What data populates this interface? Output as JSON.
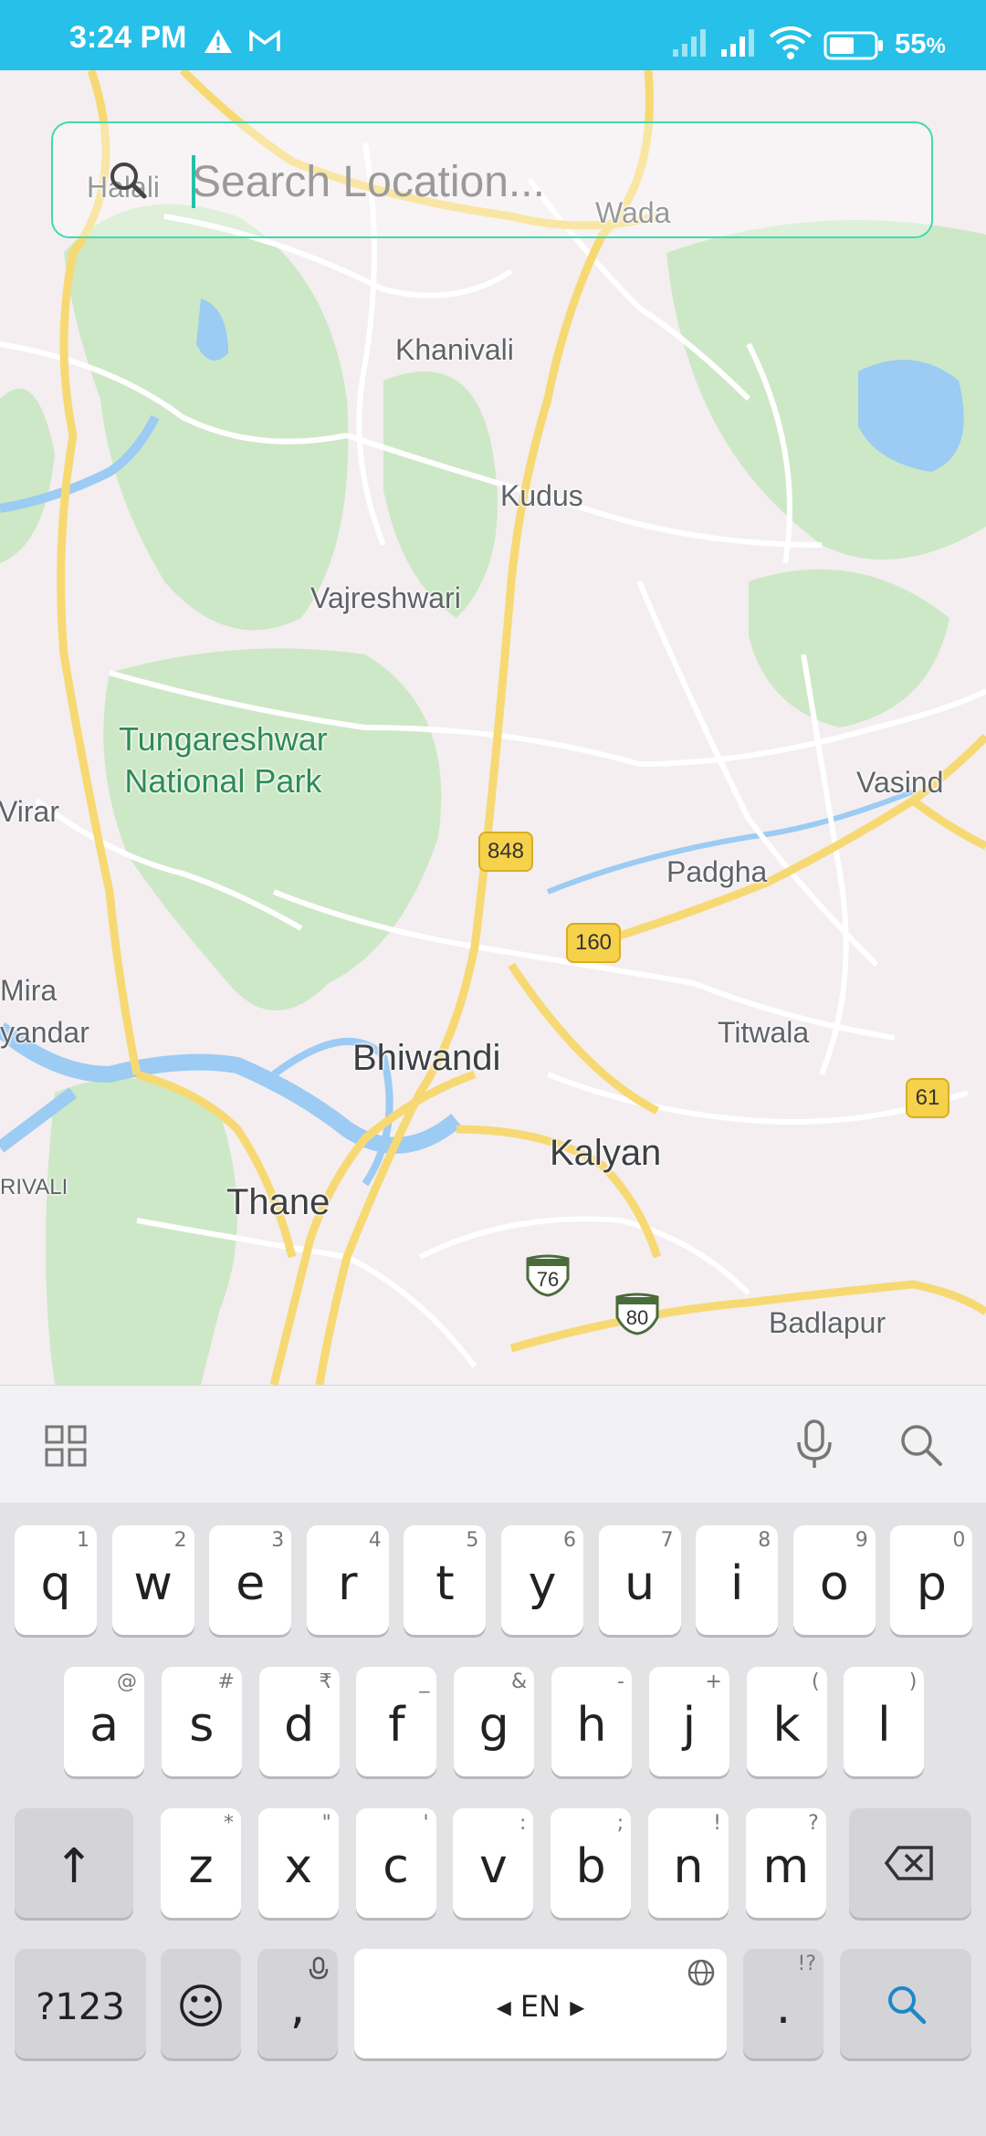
{
  "status_bar": {
    "time": "3:24 PM",
    "battery_percent": "55",
    "battery_unit": "%",
    "icons": [
      "alert-icon",
      "gmail-icon",
      "signal-icon",
      "signal-icon",
      "wifi-icon",
      "battery-icon"
    ]
  },
  "search": {
    "placeholder": "Search Location...",
    "icon": "search-icon"
  },
  "map": {
    "places": {
      "halali": "Halali",
      "wada": "Wada",
      "khanivali": "Khanivali",
      "kudus": "Kudus",
      "vajreshwari": "Vajreshwari",
      "park_line1": "Tungareshwar",
      "park_line2": "National Park",
      "virar": "Virar",
      "vasind": "Vasind",
      "padgha": "Padgha",
      "mira": "Mira",
      "bhayandar": "yandar",
      "titwala": "Titwala",
      "bhiwandi": "Bhiwandi",
      "kalyan": "Kalyan",
      "borivali": "RIVALI",
      "thane": "Thane",
      "badlapur": "Badlapur"
    },
    "shields": {
      "r848": "848",
      "r160": "160",
      "r61": "61",
      "nh76": "76",
      "nh80": "80"
    }
  },
  "keyboard": {
    "toolbar": {
      "grid_icon": "apps-grid-icon",
      "mic_icon": "microphone-icon",
      "search_icon": "search-icon"
    },
    "row1": [
      {
        "c": "q",
        "s": "1"
      },
      {
        "c": "w",
        "s": "2"
      },
      {
        "c": "e",
        "s": "3"
      },
      {
        "c": "r",
        "s": "4"
      },
      {
        "c": "t",
        "s": "5"
      },
      {
        "c": "y",
        "s": "6"
      },
      {
        "c": "u",
        "s": "7"
      },
      {
        "c": "i",
        "s": "8"
      },
      {
        "c": "o",
        "s": "9"
      },
      {
        "c": "p",
        "s": "0"
      }
    ],
    "row2": [
      {
        "c": "a",
        "s": "@"
      },
      {
        "c": "s",
        "s": "#"
      },
      {
        "c": "d",
        "s": "₹"
      },
      {
        "c": "f",
        "s": "_"
      },
      {
        "c": "g",
        "s": "&"
      },
      {
        "c": "h",
        "s": "-"
      },
      {
        "c": "j",
        "s": "+"
      },
      {
        "c": "k",
        "s": "("
      },
      {
        "c": "l",
        "s": ")"
      }
    ],
    "row3": [
      {
        "c": "z",
        "s": "*"
      },
      {
        "c": "x",
        "s": "\""
      },
      {
        "c": "c",
        "s": "'"
      },
      {
        "c": "v",
        "s": ":"
      },
      {
        "c": "b",
        "s": ";"
      },
      {
        "c": "n",
        "s": "!"
      },
      {
        "c": "m",
        "s": "?"
      }
    ],
    "shift": "↑",
    "backspace_icon": "backspace-icon",
    "symbols": "?123",
    "emoji": "☺",
    "comma": ",",
    "space_label": "EN",
    "period": ".",
    "period_sub": "!?",
    "enter_icon": "search-icon"
  }
}
